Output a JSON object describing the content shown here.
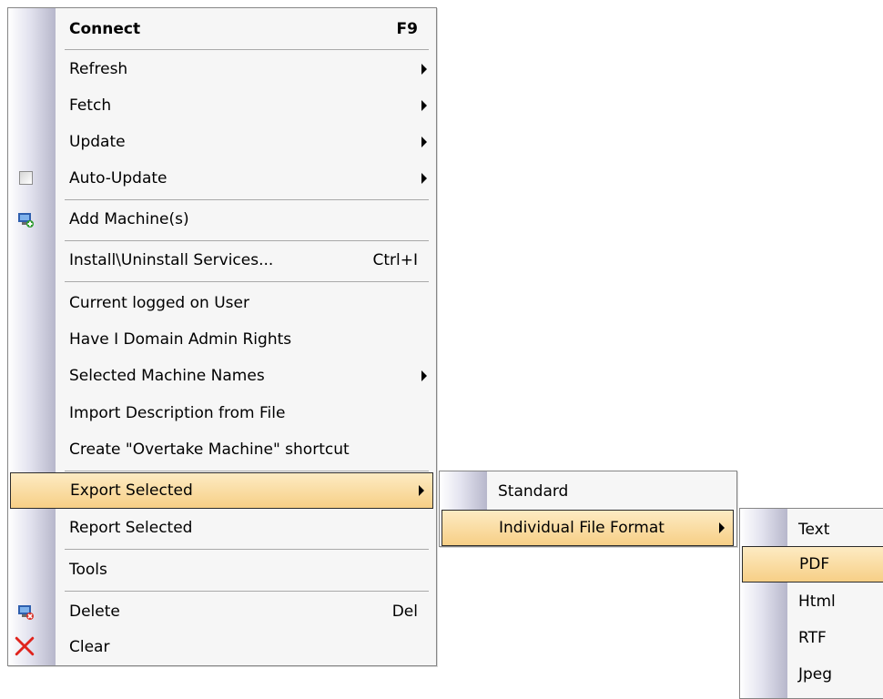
{
  "main_menu": {
    "items": [
      {
        "label": "Connect",
        "shortcut": "F9"
      },
      {
        "label": "Refresh"
      },
      {
        "label": "Fetch"
      },
      {
        "label": "Update"
      },
      {
        "label": "Auto-Update"
      },
      {
        "label": "Add Machine(s)",
        "icon": "add-machine-icon"
      },
      {
        "label": "Install\\Uninstall Services...",
        "shortcut": "Ctrl+I"
      },
      {
        "label": "Current logged on User"
      },
      {
        "label": "Have I Domain Admin Rights"
      },
      {
        "label": "Selected Machine Names"
      },
      {
        "label": "Import Description from File"
      },
      {
        "label": "Create \"Overtake Machine\" shortcut"
      },
      {
        "label": "Export Selected"
      },
      {
        "label": "Report Selected"
      },
      {
        "label": "Tools"
      },
      {
        "label": "Delete",
        "shortcut": "Del",
        "icon": "delete-machine-icon"
      },
      {
        "label": "Clear",
        "icon": "red-x-icon"
      }
    ]
  },
  "export_submenu": {
    "items": [
      {
        "label": "Standard"
      },
      {
        "label": "Individual File Format"
      }
    ]
  },
  "format_submenu": {
    "items": [
      {
        "label": "Text"
      },
      {
        "label": "PDF"
      },
      {
        "label": "Html"
      },
      {
        "label": "RTF"
      },
      {
        "label": "Jpeg"
      }
    ]
  },
  "colors": {
    "highlight_top": "#fdebc3",
    "highlight_bottom": "#f7cf86",
    "menu_background": "#f6f6f6",
    "menu_border": "#868686"
  }
}
